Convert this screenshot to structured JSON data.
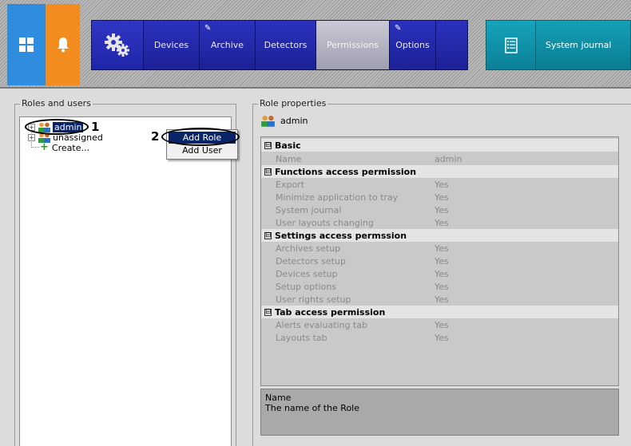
{
  "nav": {
    "tabs": [
      {
        "label": "Devices",
        "active": false,
        "editable": false
      },
      {
        "label": "Archive",
        "active": false,
        "editable": true
      },
      {
        "label": "Detectors",
        "active": false,
        "editable": false
      },
      {
        "label": "Permissions",
        "active": true,
        "editable": false
      },
      {
        "label": "Options",
        "active": false,
        "editable": true
      }
    ],
    "journal_label": "System journal"
  },
  "left_panel": {
    "title": "Roles and users",
    "tree": {
      "admin": "admin",
      "unassigned": "unassigned",
      "create": "Create..."
    },
    "context_menu": {
      "add_role": "Add Role",
      "add_user": "Add User"
    },
    "callouts": {
      "one": "1",
      "two": "2"
    }
  },
  "right_panel": {
    "title": "Role properties",
    "role_name": "admin",
    "categories": [
      {
        "label": "Basic",
        "rows": [
          {
            "name": "Name",
            "value": "admin"
          }
        ]
      },
      {
        "label": "Functions access permission",
        "rows": [
          {
            "name": "Export",
            "value": "Yes"
          },
          {
            "name": "Minimize application to tray",
            "value": "Yes"
          },
          {
            "name": "System journal",
            "value": "Yes"
          },
          {
            "name": "User layouts changing",
            "value": "Yes"
          }
        ]
      },
      {
        "label": "Settings access permssion",
        "rows": [
          {
            "name": "Archives setup",
            "value": "Yes"
          },
          {
            "name": "Detectors setup",
            "value": "Yes"
          },
          {
            "name": "Devices setup",
            "value": "Yes"
          },
          {
            "name": "Setup options",
            "value": "Yes"
          },
          {
            "name": "User rights setup",
            "value": "Yes"
          }
        ]
      },
      {
        "label": "Tab access permission",
        "rows": [
          {
            "name": "Alerts evaluating tab",
            "value": "Yes"
          },
          {
            "name": "Layouts tab",
            "value": "Yes"
          }
        ]
      }
    ],
    "collapse_symbol": "⊟",
    "description": {
      "title": "Name",
      "text": "The name of the Role"
    }
  },
  "colors": {
    "selection": "#0a246a",
    "nav_blue": "#1a1f8a",
    "teal": "#0c8aa0",
    "tile_blue": "#2f8de0",
    "tile_orange": "#f28c1e"
  }
}
